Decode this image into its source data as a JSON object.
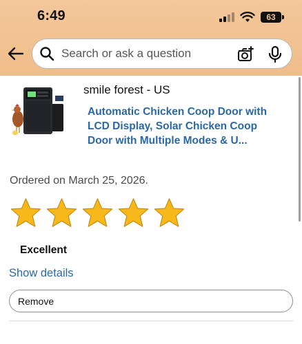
{
  "status_bar": {
    "time": "6:49",
    "battery": "63"
  },
  "header": {
    "search_placeholder": "Search or ask a question",
    "accent_color": "#f1c190"
  },
  "product": {
    "seller": "smile forest - US",
    "title": "Automatic Chicken Coop Door with LCD Display, Solar Chicken Coop Door with Multiple Modes & U...",
    "ordered_text": "Ordered on March 25, 2026.",
    "image_icon": "chicken-coop-door-product-image"
  },
  "review": {
    "rating": 5,
    "max_rating": 5,
    "rating_label": "Excellent",
    "star_color": "#f6b81a"
  },
  "actions": {
    "show_details": "Show details",
    "remove": "Remove"
  }
}
